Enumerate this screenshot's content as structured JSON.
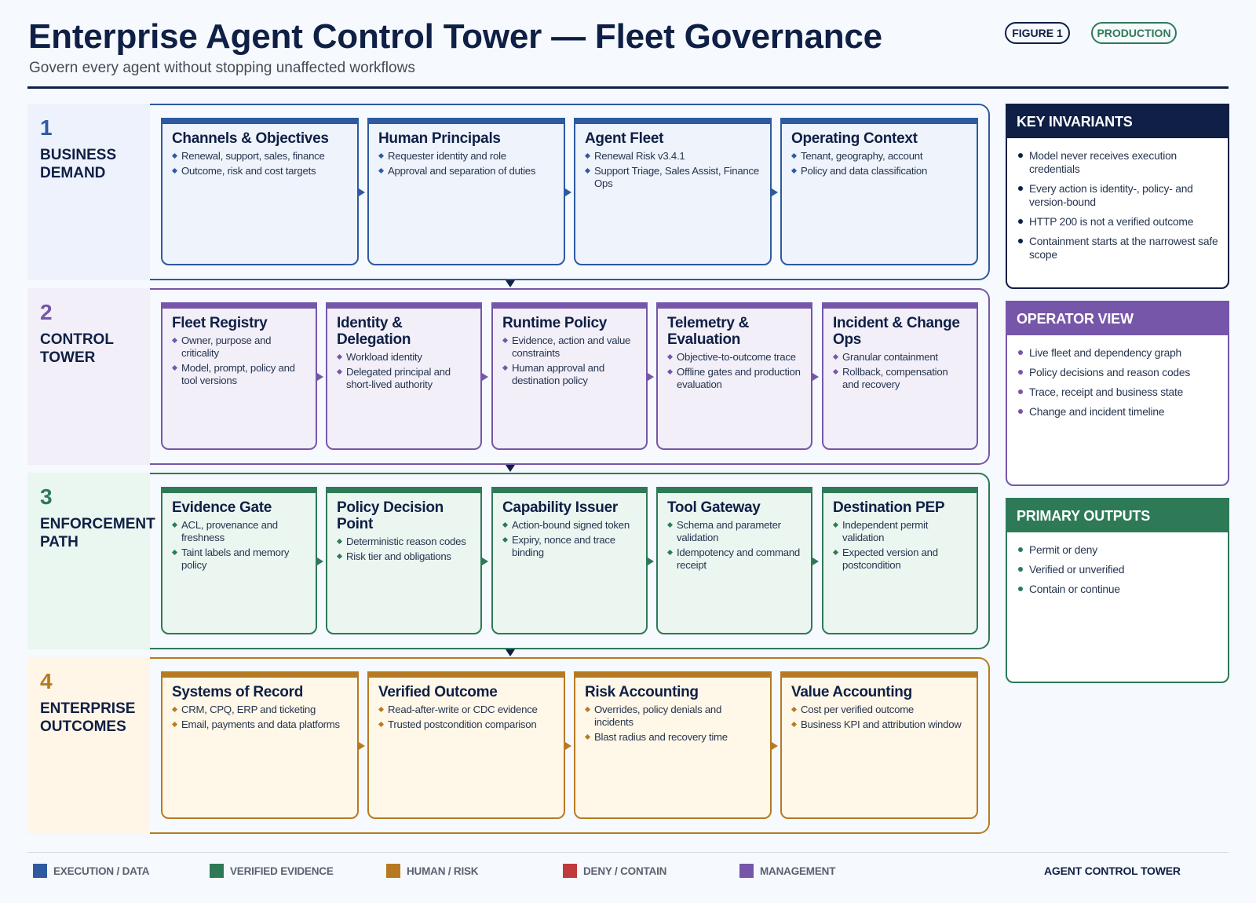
{
  "header": {
    "title": "Enterprise Agent Control Tower — Fleet Governance",
    "subtitle": "Govern every agent without stopping unaffected workflows",
    "figure_badge": "FIGURE 1",
    "status_badge": "PRODUCTION"
  },
  "colors": {
    "navy": "#0f1f45",
    "blue": "#2e5aa0",
    "purple": "#7656a8",
    "green": "#2e7a57",
    "orange": "#b77a22",
    "red": "#c0393b"
  },
  "bands": [
    {
      "number": "1",
      "name": "BUSINESS DEMAND",
      "cards": [
        {
          "title": "Channels & Objectives",
          "items": [
            "Renewal, support, sales, finance",
            "Outcome, risk and cost targets"
          ]
        },
        {
          "title": "Human Principals",
          "items": [
            "Requester identity and role",
            "Approval and separation of duties"
          ]
        },
        {
          "title": "Agent Fleet",
          "items": [
            "Renewal Risk v3.4.1",
            "Support Triage, Sales Assist, Finance Ops"
          ]
        },
        {
          "title": "Operating Context",
          "items": [
            "Tenant, geography, account",
            "Policy and data classification"
          ]
        }
      ]
    },
    {
      "number": "2",
      "name": "CONTROL TOWER",
      "cards": [
        {
          "title": "Fleet Registry",
          "items": [
            "Owner, purpose and criticality",
            "Model, prompt, policy and tool versions"
          ]
        },
        {
          "title": "Identity & Delegation",
          "items": [
            "Workload identity",
            "Delegated principal and short-lived authority"
          ]
        },
        {
          "title": "Runtime Policy",
          "items": [
            "Evidence, action and value constraints",
            "Human approval and destination policy"
          ]
        },
        {
          "title": "Telemetry & Evaluation",
          "items": [
            "Objective-to-outcome trace",
            "Offline gates and production evaluation"
          ]
        },
        {
          "title": "Incident & Change Ops",
          "items": [
            "Granular containment",
            "Rollback, compensation and recovery"
          ]
        }
      ]
    },
    {
      "number": "3",
      "name": "ENFORCEMENT PATH",
      "cards": [
        {
          "title": "Evidence Gate",
          "items": [
            "ACL, provenance and freshness",
            "Taint labels and memory policy"
          ]
        },
        {
          "title": "Policy Decision Point",
          "items": [
            "Deterministic reason codes",
            "Risk tier and obligations"
          ]
        },
        {
          "title": "Capability Issuer",
          "items": [
            "Action-bound signed token",
            "Expiry, nonce and trace binding"
          ]
        },
        {
          "title": "Tool Gateway",
          "items": [
            "Schema and parameter validation",
            "Idempotency and command receipt"
          ]
        },
        {
          "title": "Destination PEP",
          "items": [
            "Independent permit validation",
            "Expected version and postcondition"
          ]
        }
      ]
    },
    {
      "number": "4",
      "name": "ENTERPRISE OUTCOMES",
      "cards": [
        {
          "title": "Systems of Record",
          "items": [
            "CRM, CPQ, ERP and ticketing",
            "Email, payments and data platforms"
          ]
        },
        {
          "title": "Verified Outcome",
          "items": [
            "Read-after-write or CDC evidence",
            "Trusted postcondition comparison"
          ]
        },
        {
          "title": "Risk Accounting",
          "items": [
            "Overrides, policy denials and incidents",
            "Blast radius and recovery time"
          ]
        },
        {
          "title": "Value Accounting",
          "items": [
            "Cost per verified outcome",
            "Business KPI and attribution window"
          ]
        }
      ]
    }
  ],
  "side_panels": [
    {
      "title": "KEY INVARIANTS",
      "items": [
        "Model never receives execution credentials",
        "Every action is identity-, policy- and version-bound",
        "HTTP 200 is not a verified outcome",
        "Containment starts at the narrowest safe scope"
      ]
    },
    {
      "title": "OPERATOR VIEW",
      "items": [
        "Live fleet and dependency graph",
        "Policy decisions and reason codes",
        "Trace, receipt and business state",
        "Change and incident timeline"
      ]
    },
    {
      "title": "PRIMARY OUTPUTS",
      "items": [
        "Permit or deny",
        "Verified or unverified",
        "Contain or continue"
      ]
    }
  ],
  "legend": [
    {
      "label": "EXECUTION / DATA",
      "color": "#2e5aa0"
    },
    {
      "label": "VERIFIED EVIDENCE",
      "color": "#2e7a57"
    },
    {
      "label": "HUMAN / RISK",
      "color": "#b77a22"
    },
    {
      "label": "DENY / CONTAIN",
      "color": "#c0393b"
    },
    {
      "label": "MANAGEMENT",
      "color": "#7656a8"
    }
  ],
  "footer": {
    "brand": "AGENT CONTROL TOWER"
  }
}
